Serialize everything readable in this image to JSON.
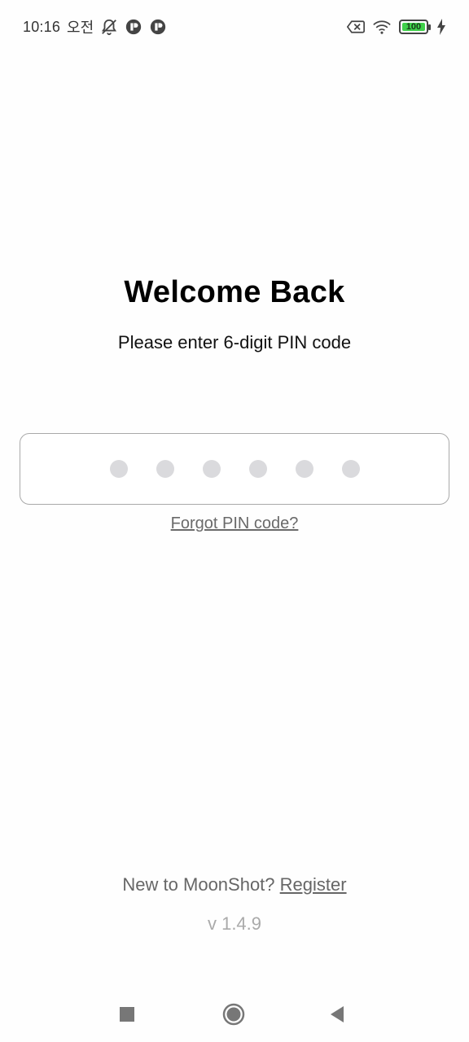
{
  "status_bar": {
    "time": "10:16",
    "ampm": "오전",
    "battery_level": "100",
    "icons": [
      "bell-off-icon",
      "app-notification-icon",
      "app-notification-icon",
      "data-saver-icon",
      "wifi-icon",
      "battery-icon",
      "charging-icon"
    ]
  },
  "main": {
    "title": "Welcome Back",
    "subtitle": "Please enter 6-digit PIN code",
    "pin_length": 6,
    "forgot_label": "Forgot PIN code?"
  },
  "footer": {
    "register_prompt": "New to MoonShot?",
    "register_label": "Register",
    "version": "v 1.4.9"
  },
  "nav_bar": {
    "icons": [
      "recent-apps-icon",
      "home-icon",
      "back-icon"
    ]
  },
  "colors": {
    "pin_dot": "#dadadd",
    "battery_fill": "#3fd04a"
  }
}
